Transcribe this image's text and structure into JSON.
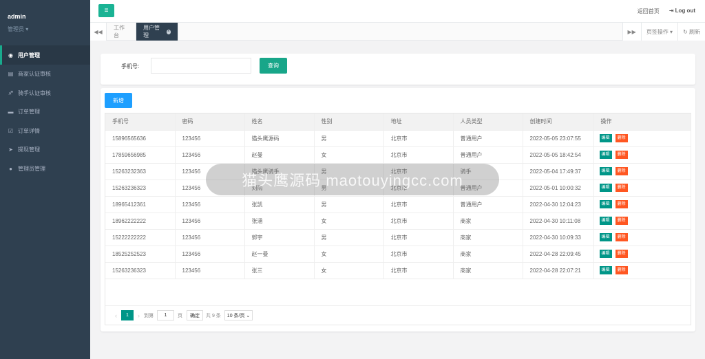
{
  "sidebar": {
    "user_name": "admin",
    "user_role": "管理员 ▾",
    "items": [
      {
        "label": "用户管理",
        "icon": "user-circle-icon",
        "glyph": "◉",
        "active": true
      },
      {
        "label": "商家认证审核",
        "icon": "id-card-icon",
        "glyph": "▤"
      },
      {
        "label": "骑手认证审核",
        "icon": "rider-icon",
        "glyph": "♐"
      },
      {
        "label": "订单管理",
        "icon": "credit-card-icon",
        "glyph": "▬"
      },
      {
        "label": "订单详情",
        "icon": "check-square-icon",
        "glyph": "☑"
      },
      {
        "label": "提现管理",
        "icon": "send-icon",
        "glyph": "➤"
      },
      {
        "label": "管理员管理",
        "icon": "user-icon",
        "glyph": "●"
      }
    ]
  },
  "topbar": {
    "menu_glyph": "≡",
    "home_label": "返回首页",
    "logout_label": "Log out"
  },
  "tabs": {
    "items": [
      {
        "label": "工作台",
        "active": false
      },
      {
        "label": "用户管理",
        "active": true
      }
    ],
    "close_glyph": "×",
    "page_ops_label": "页签操作 ▾",
    "refresh_label": "↻ 刷新",
    "left_glyph": "◀◀",
    "right_glyph": "▶▶"
  },
  "search": {
    "phone_label": "手机号:",
    "phone_value": "",
    "query_label": "查询"
  },
  "table": {
    "add_label": "新增",
    "columns": [
      "手机号",
      "密码",
      "姓名",
      "性别",
      "地址",
      "人员类型",
      "创建时间",
      "操作"
    ],
    "rows": [
      [
        "15896565636",
        "123456",
        "猫头鹰源码",
        "男",
        "北京市",
        "普通用户",
        "2022-05-05 23:07:55"
      ],
      [
        "17859656985",
        "123456",
        "赵曼",
        "女",
        "北京市",
        "普通用户",
        "2022-05-05 18:42:54"
      ],
      [
        "15263232363",
        "123456",
        "猫头鹰骑手",
        "男",
        "北京市",
        "骑手",
        "2022-05-04 17:49:37"
      ],
      [
        "15263236323",
        "123456",
        "刘雨",
        "男",
        "北京市",
        "普通用户",
        "2022-05-01 10:00:32"
      ],
      [
        "18965412361",
        "123456",
        "张凯",
        "男",
        "北京市",
        "普通用户",
        "2022-04-30 12:04:23"
      ],
      [
        "18962222222",
        "123456",
        "张涵",
        "女",
        "北京市",
        "商家",
        "2022-04-30 10:11:08"
      ],
      [
        "15222222222",
        "123456",
        "郭宇",
        "男",
        "北京市",
        "商家",
        "2022-04-30 10:09:33"
      ],
      [
        "18525252523",
        "123456",
        "赵一曼",
        "女",
        "北京市",
        "商家",
        "2022-04-28 22:09:45"
      ],
      [
        "15263236323",
        "123456",
        "张三",
        "女",
        "北京市",
        "商家",
        "2022-04-28 22:07:21"
      ]
    ],
    "edit_label": "编辑",
    "delete_label": "删除"
  },
  "pager": {
    "prev_glyph": "‹",
    "next_glyph": "›",
    "current_page": "1",
    "goto_label": "到第",
    "goto_value": "1",
    "page_unit": "页",
    "confirm_label": "确定",
    "total_label": "共 9 条",
    "page_size_label": "10 条/页 ⌄"
  },
  "watermark": "猫头鹰源码 maotouyingcc.com",
  "colors": {
    "sidebar_bg": "#2f4050",
    "accent_green": "#1ab394",
    "add_blue": "#1e9fff",
    "edit_teal": "#009688",
    "delete_orange": "#ff5722"
  }
}
